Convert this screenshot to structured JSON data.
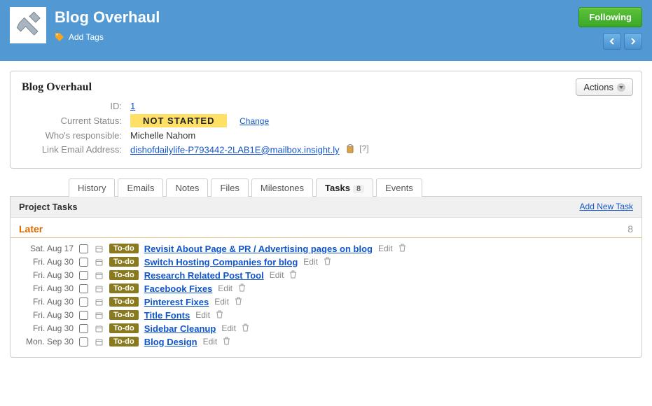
{
  "header": {
    "title": "Blog Overhaul",
    "add_tags": "Add Tags",
    "following": "Following"
  },
  "details": {
    "card_title": "Blog Overhaul",
    "actions_label": "Actions",
    "id_label": "ID:",
    "id_value": "1",
    "status_label": "Current Status:",
    "status_value": "NOT STARTED",
    "change_label": "Change",
    "responsible_label": "Who's responsible:",
    "responsible_value": "Michelle Nahom",
    "email_label": "Link Email Address:",
    "email_value": "dishofdailylife-P793442-2LAB1E@mailbox.insight.ly",
    "help_marker": "[?]"
  },
  "tabs": [
    {
      "label": "History"
    },
    {
      "label": "Emails"
    },
    {
      "label": "Notes"
    },
    {
      "label": "Files"
    },
    {
      "label": "Milestones"
    },
    {
      "label": "Tasks",
      "count": "8"
    },
    {
      "label": "Events"
    }
  ],
  "tasks_panel": {
    "title": "Project Tasks",
    "add_new": "Add New Task",
    "section_label": "Later",
    "section_count": "8",
    "edit_label": "Edit",
    "todo_label": "To-do",
    "items": [
      {
        "date": "Sat. Aug 17",
        "title": "Revisit About Page & PR / Advertising pages on blog"
      },
      {
        "date": "Fri. Aug 30",
        "title": "Switch Hosting Companies for blog"
      },
      {
        "date": "Fri. Aug 30",
        "title": "Research Related Post Tool "
      },
      {
        "date": "Fri. Aug 30",
        "title": "Facebook Fixes"
      },
      {
        "date": "Fri. Aug 30",
        "title": "Pinterest Fixes"
      },
      {
        "date": "Fri. Aug 30",
        "title": "Title Fonts"
      },
      {
        "date": "Fri. Aug 30",
        "title": "Sidebar Cleanup"
      },
      {
        "date": "Mon. Sep 30",
        "title": "Blog Design"
      }
    ]
  }
}
